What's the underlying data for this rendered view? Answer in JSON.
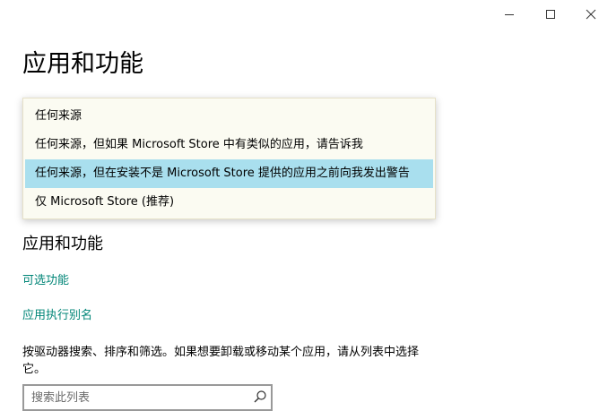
{
  "window": {
    "buttons": {
      "minimize_icon": "minimize-icon",
      "maximize_icon": "maximize-icon",
      "close_icon": "close-icon"
    }
  },
  "page": {
    "title": "应用和功能"
  },
  "install_source_dropdown": {
    "options": [
      {
        "label": "任何来源",
        "selected": false
      },
      {
        "label": "任何来源，但如果 Microsoft Store 中有类似的应用，请告诉我",
        "selected": false
      },
      {
        "label": "任何来源，但在安装不是 Microsoft Store 提供的应用之前向我发出警告",
        "selected": true
      },
      {
        "label": "仅 Microsoft Store (推荐)",
        "selected": false
      }
    ],
    "highlight_color": "#a9dfee"
  },
  "apps_section": {
    "heading": "应用和功能",
    "links": {
      "optional_features": "可选功能",
      "app_execution_aliases": "应用执行别名"
    },
    "description": "按驱动器搜索、排序和筛选。如果想要卸载或移动某个应用，请从列表中选择它。",
    "search": {
      "value": "",
      "placeholder": "搜索此列表",
      "icon": "search-icon"
    }
  },
  "colors": {
    "link": "#008577",
    "dropdown_background": "#fbfbf2"
  }
}
